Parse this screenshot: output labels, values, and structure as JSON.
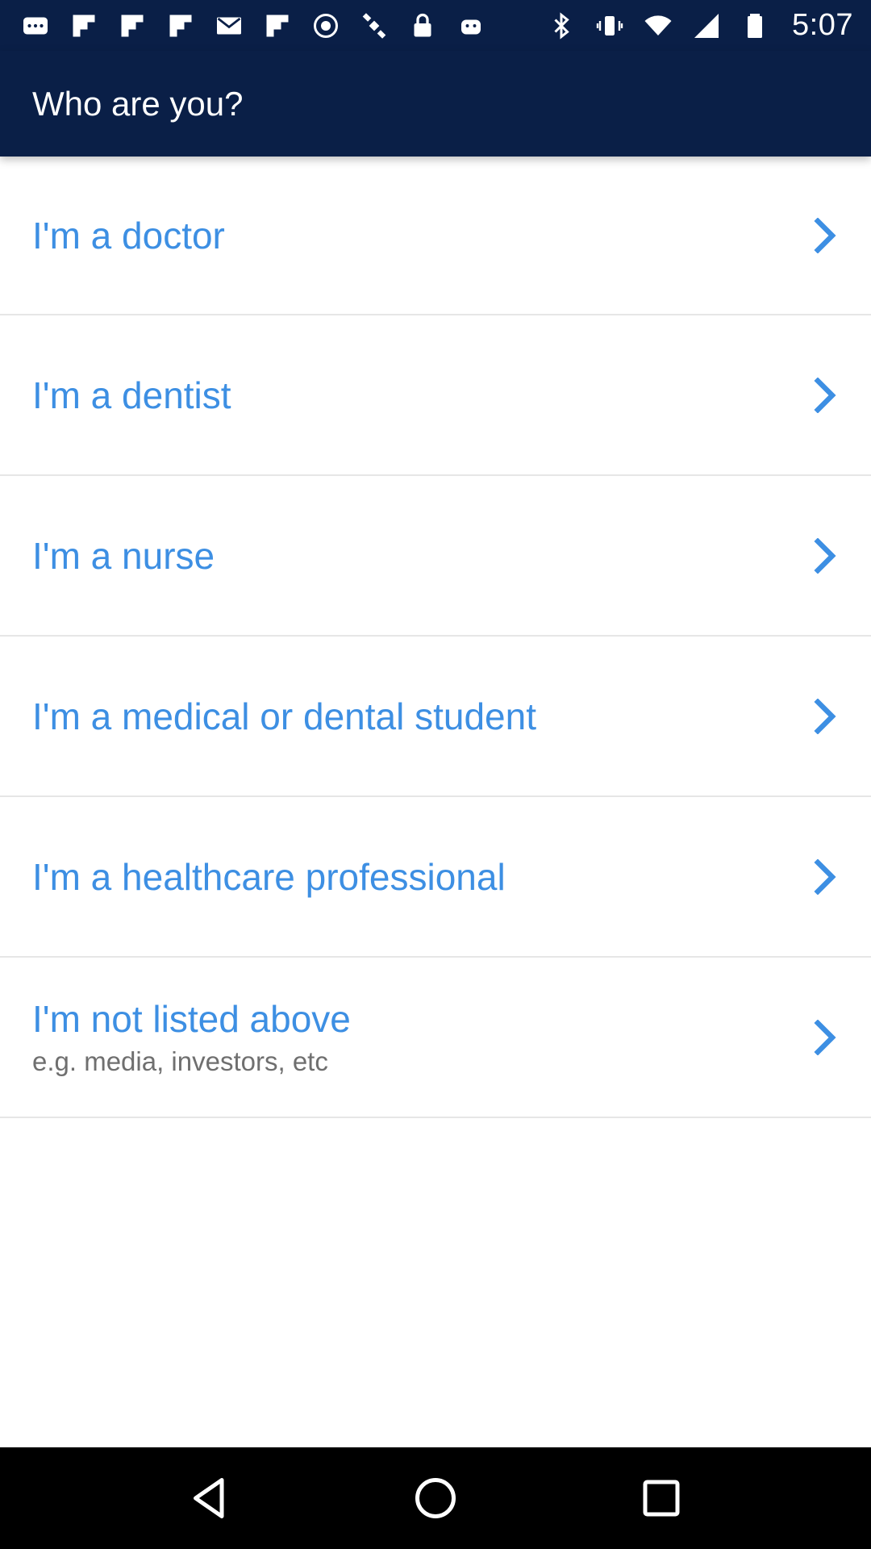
{
  "status_bar": {
    "time": "5:07",
    "icons": [
      "messages-icon",
      "flipboard-icon",
      "flipboard-icon",
      "flipboard-icon",
      "email-icon",
      "flipboard-icon",
      "fake-gps-icon",
      "satellite-icon",
      "lock-icon",
      "android-icon",
      "bluetooth-icon",
      "vibrate-icon",
      "wifi-icon",
      "signal-icon",
      "battery-icon"
    ]
  },
  "header": {
    "title": "Who are you?"
  },
  "options": [
    {
      "label": "I'm a doctor",
      "sublabel": ""
    },
    {
      "label": "I'm a dentist",
      "sublabel": ""
    },
    {
      "label": "I'm a nurse",
      "sublabel": ""
    },
    {
      "label": "I'm a medical or dental student",
      "sublabel": ""
    },
    {
      "label": "I'm a healthcare professional",
      "sublabel": ""
    },
    {
      "label": "I'm not listed above",
      "sublabel": "e.g. media, investors, etc"
    }
  ],
  "colors": {
    "header_bg": "#0a1f47",
    "accent": "#3d8fe3",
    "divider": "#e6e6e6",
    "nav_bg": "#000000"
  },
  "nav": {
    "icons": [
      "back-icon",
      "home-icon",
      "recents-icon"
    ]
  }
}
